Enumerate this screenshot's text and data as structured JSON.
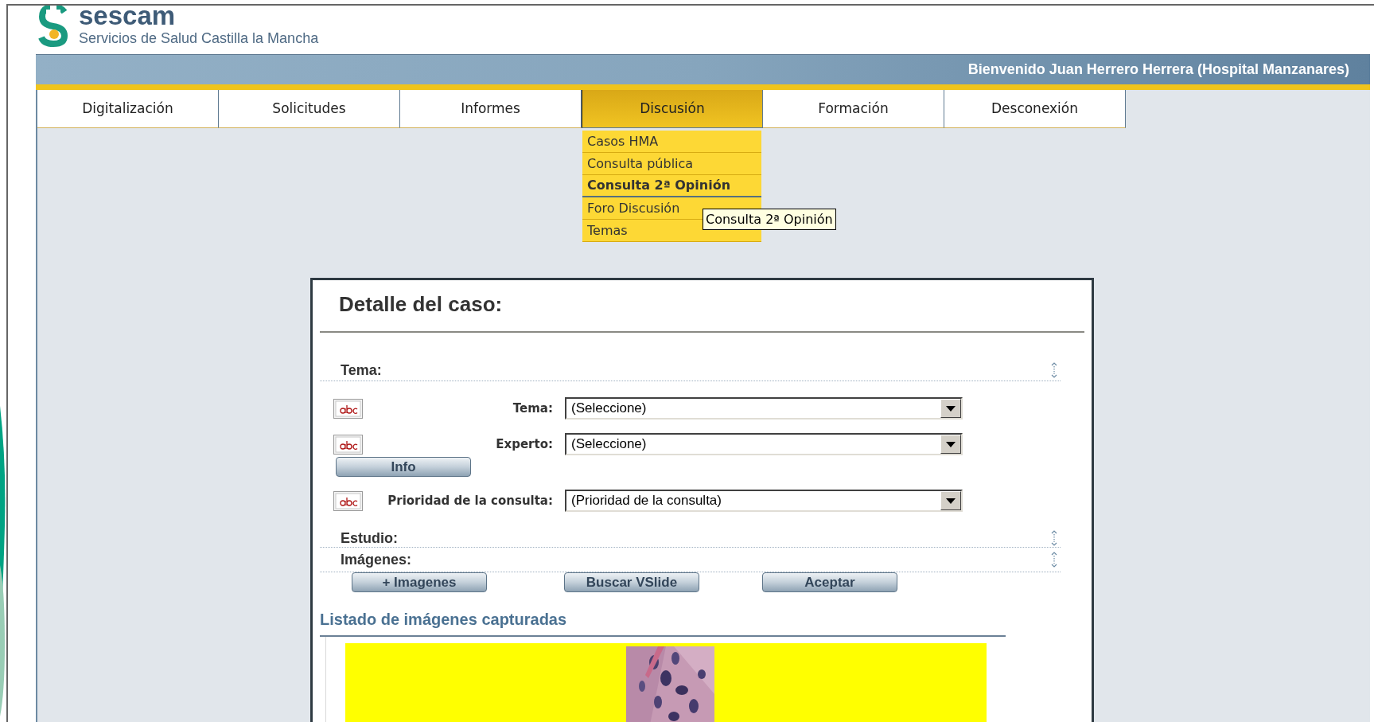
{
  "header": {
    "logo_text": "sescam",
    "subtitle": "Servicios de Salud Castilla la Mancha"
  },
  "welcome": "Bienvenido Juan Herrero Herrera (Hospital Manzanares)",
  "tabs": [
    {
      "label": "Digitalización",
      "selected": false
    },
    {
      "label": "Solicitudes",
      "selected": false
    },
    {
      "label": "Informes",
      "selected": false
    },
    {
      "label": "Discusión",
      "selected": true
    },
    {
      "label": "Formación",
      "selected": false
    },
    {
      "label": "Desconexión",
      "selected": false
    }
  ],
  "menu": {
    "items": [
      {
        "label": "Casos HMA",
        "selected": false
      },
      {
        "label": "Consulta pública",
        "selected": false
      },
      {
        "label": "Consulta 2ª Opinión",
        "selected": true
      },
      {
        "label": "Foro Discusión",
        "selected": false
      },
      {
        "label": "Temas",
        "selected": false
      }
    ]
  },
  "tooltip": "Consulta 2ª Opinión",
  "card": {
    "title": "Detalle del caso:",
    "tema_section": {
      "title": "Tema:",
      "fields": [
        {
          "label": "Tema:",
          "value": "(Seleccione)"
        },
        {
          "label": "Experto:",
          "value": "(Seleccione)",
          "button": "Info"
        },
        {
          "label": "Prioridad de la consulta:",
          "value": "(Prioridad de la consulta)"
        }
      ]
    },
    "estudio_section": {
      "title": "Estudio:"
    },
    "imagenes_section": {
      "title": "Imágenes:"
    },
    "buttons": [
      "+ Imagenes",
      "Buscar VSlide",
      "Aceptar"
    ],
    "list_title": "Listado de imágenes capturadas"
  }
}
